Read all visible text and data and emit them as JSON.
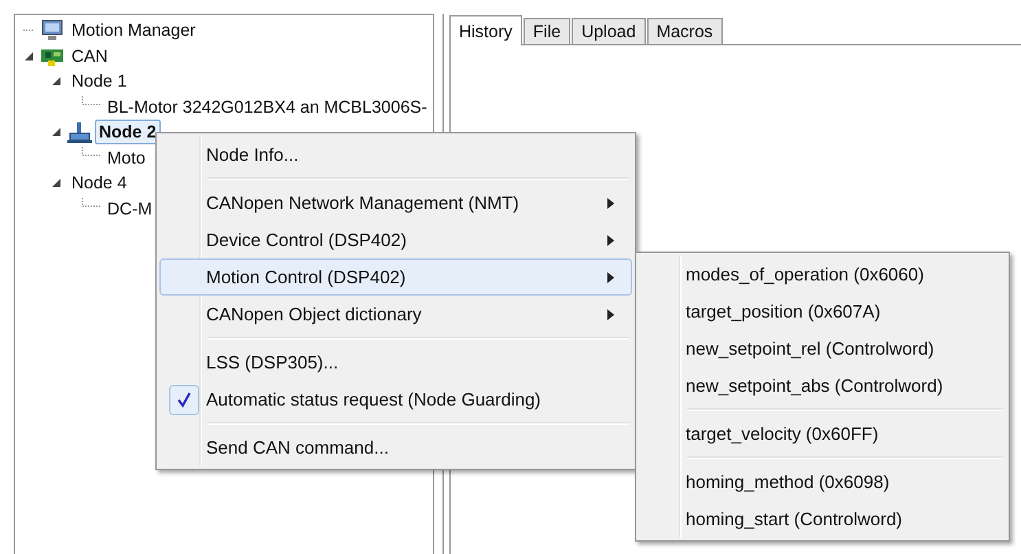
{
  "tree": [
    {
      "label": "Motion Manager",
      "kind": "computer",
      "expanded": false,
      "selected": false
    },
    {
      "label": "CAN",
      "kind": "bus",
      "expanded": true,
      "selected": false,
      "children": [
        {
          "label": "Node 1",
          "expanded": true,
          "selected": false,
          "children": [
            {
              "label": "BL-Motor 3242G012BX4 an MCBL3006S-",
              "expanded": false,
              "selected": false
            }
          ]
        },
        {
          "label": "Node 2",
          "kind": "drive",
          "expanded": true,
          "selected": true,
          "children": [
            {
              "label": "Moto",
              "expanded": false,
              "selected": false
            }
          ]
        },
        {
          "label": "Node 4",
          "expanded": true,
          "selected": false,
          "children": [
            {
              "label": "DC-M",
              "expanded": false,
              "selected": false
            }
          ]
        }
      ]
    }
  ],
  "tabs": [
    {
      "label": "History",
      "selected": true
    },
    {
      "label": "File",
      "selected": false
    },
    {
      "label": "Upload",
      "selected": false
    },
    {
      "label": "Macros",
      "selected": false
    }
  ],
  "context_menu": {
    "items": [
      {
        "kind": "item",
        "label": "Node Info...",
        "submenu": false,
        "highlighted": false,
        "checked": false
      },
      {
        "kind": "separator"
      },
      {
        "kind": "item",
        "label": "CANopen Network Management (NMT)",
        "submenu": true,
        "highlighted": false,
        "checked": false
      },
      {
        "kind": "item",
        "label": "Device Control (DSP402)",
        "submenu": true,
        "highlighted": false,
        "checked": false
      },
      {
        "kind": "item",
        "label": "Motion Control (DSP402)",
        "submenu": true,
        "highlighted": true,
        "checked": false
      },
      {
        "kind": "item",
        "label": "CANopen Object dictionary",
        "submenu": true,
        "highlighted": false,
        "checked": false
      },
      {
        "kind": "separator"
      },
      {
        "kind": "item",
        "label": "LSS (DSP305)...",
        "submenu": false,
        "highlighted": false,
        "checked": false
      },
      {
        "kind": "item",
        "label": "Automatic status request (Node Guarding)",
        "submenu": false,
        "highlighted": false,
        "checked": true
      },
      {
        "kind": "separator"
      },
      {
        "kind": "item",
        "label": "Send CAN command...",
        "submenu": false,
        "highlighted": false,
        "checked": false
      }
    ]
  },
  "submenu": {
    "items": [
      {
        "kind": "item",
        "label": "modes_of_operation (0x6060)"
      },
      {
        "kind": "item",
        "label": "target_position (0x607A)"
      },
      {
        "kind": "item",
        "label": "new_setpoint_rel (Controlword)"
      },
      {
        "kind": "item",
        "label": "new_setpoint_abs (Controlword)"
      },
      {
        "kind": "separator"
      },
      {
        "kind": "item",
        "label": "target_velocity (0x60FF)"
      },
      {
        "kind": "separator"
      },
      {
        "kind": "item",
        "label": "homing_method (0x6098)"
      },
      {
        "kind": "item",
        "label": "homing_start (Controlword)"
      }
    ]
  }
}
